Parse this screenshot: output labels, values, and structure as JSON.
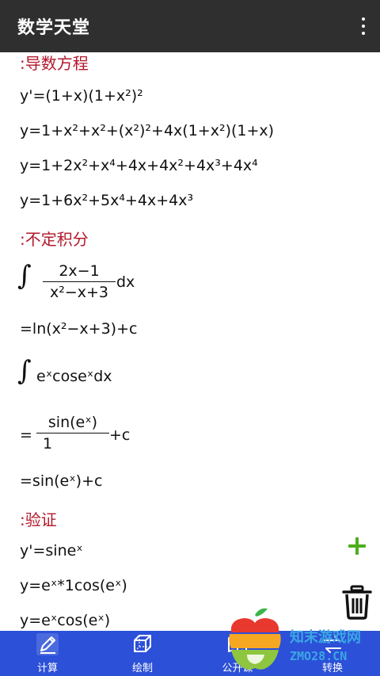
{
  "appbar": {
    "title": "数学天堂",
    "menu_icon": "more-vert-icon"
  },
  "sections": {
    "derivative": {
      "heading": ":导数方程",
      "lines": [
        "y'=(1+x)(1+x²)²",
        "y=1+x²+x²+(x²)²+4x(1+x²)(1+x)",
        "y=1+2x²+x⁴+4x+4x²+4x³+4x⁴",
        "y=1+6x²+5x⁴+4x+4x³"
      ]
    },
    "integral": {
      "heading": ":不定积分",
      "expr1_num": "2x−1",
      "expr1_den": "x²−x+3",
      "expr1_tail": "dx",
      "result1": "=ln(x²−x+3)+c",
      "expr2": "eˣcoseˣdx",
      "result2_prefix": "=",
      "result2_num": "sin(eˣ)",
      "result2_den": "1",
      "result2_tail": "+c",
      "result3": "=sin(eˣ)+c"
    },
    "verify": {
      "heading": ":验证",
      "lines": [
        "y'=sineˣ",
        "y=eˣ*1cos(eˣ)",
        "y=eˣcos(eˣ)"
      ]
    }
  },
  "actions": {
    "add_icon": "plus-icon",
    "delete_icon": "trash-icon"
  },
  "bottom_nav": [
    {
      "label": "计算",
      "icon": "pencil-icon"
    },
    {
      "label": "绘制",
      "icon": "cube-icon"
    },
    {
      "label": "公开课",
      "icon": "book-icon"
    },
    {
      "label": "转换",
      "icon": "convert-icon"
    }
  ],
  "watermark": {
    "line1": "知末游戏网",
    "line2": "ZMO28.CN"
  },
  "colors": {
    "appbar": "#2f2f2f",
    "heading": "#b3182b",
    "bottom_nav": "#2c50d8",
    "add": "#4caf1e"
  }
}
